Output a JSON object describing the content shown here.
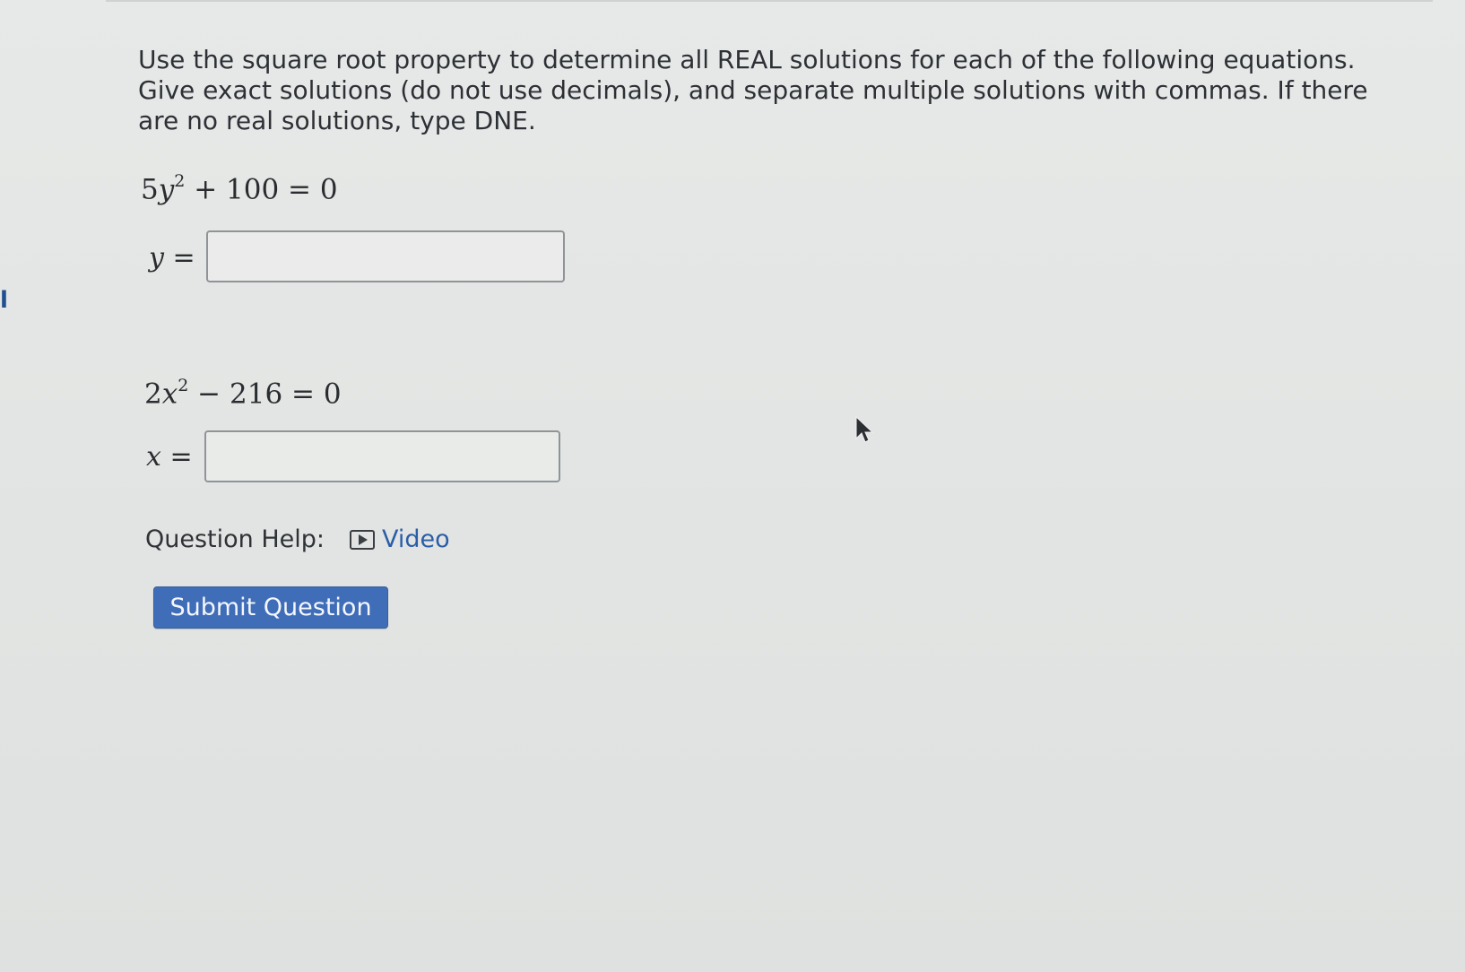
{
  "instructions": "Use the square root property to determine all REAL solutions for each of the following equations. Give exact solutions (do not use decimals), and separate multiple solutions with commas. If there are no real solutions, type DNE.",
  "questions": [
    {
      "equation": {
        "coef": "5",
        "var": "y",
        "power": "2",
        "rest": " + 100 = 0"
      },
      "variable": "y",
      "equals": " =",
      "answer_value": ""
    },
    {
      "equation": {
        "coef": "2",
        "var": "x",
        "power": "2",
        "rest": " − 216 = 0"
      },
      "variable": "x",
      "equals": " =",
      "answer_value": ""
    }
  ],
  "help": {
    "label": "Question Help:",
    "video_label": "Video",
    "icon": "video-play-icon"
  },
  "submit_label": "Submit Question",
  "colors": {
    "submit_bg": "#3f6db8",
    "link": "#2a5da8",
    "text": "#2d3135",
    "background": "#e5e7e6"
  }
}
